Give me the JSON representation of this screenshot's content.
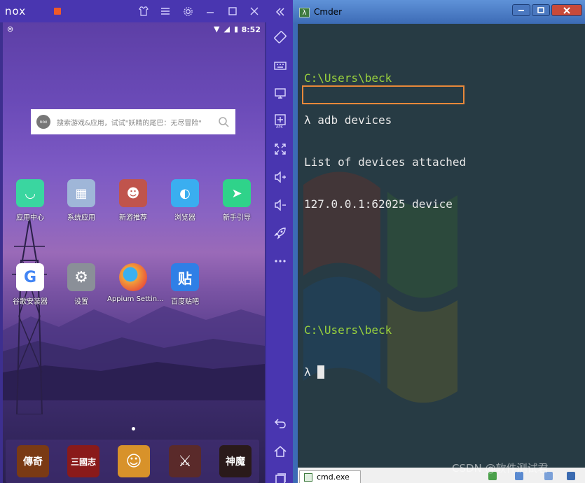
{
  "nox": {
    "logo": "nox",
    "status": {
      "time": "8:52",
      "battery": "▮",
      "wifi": "▼"
    },
    "search": {
      "placeholder": "搜索游戏&应用，试试\"妖精的尾巴：无尽冒险\"",
      "logo_text": "nox"
    },
    "apps_row1": [
      {
        "label": "应用中心",
        "color": "#3ad6a0",
        "glyph": "◡"
      },
      {
        "label": "系统应用",
        "color": "#9fb6d8",
        "glyph": "▦"
      },
      {
        "label": "新游推荐",
        "color": "#c0544c",
        "glyph": "☻"
      },
      {
        "label": "浏览器",
        "color": "#3aaef0",
        "glyph": "◐"
      },
      {
        "label": "新手引导",
        "color": "#2fd38a",
        "glyph": "➤"
      }
    ],
    "apps_row2": [
      {
        "label": "谷歌安装器",
        "color": "#ffffff",
        "glyph": "G"
      },
      {
        "label": "设置",
        "color": "#8a8f98",
        "glyph": "⚙"
      },
      {
        "label": "Appium Settin...",
        "color": "#f2a23a",
        "glyph": "◔"
      },
      {
        "label": "百度贴吧",
        "color": "#2f7fe6",
        "glyph": "贴"
      }
    ],
    "dock": [
      {
        "label": "傳奇",
        "color": "#7a3a14"
      },
      {
        "label": "三國志",
        "color": "#8a1a1a"
      },
      {
        "label": "☺",
        "color": "#d8922a"
      },
      {
        "label": "⚔",
        "color": "#5a2a2a"
      },
      {
        "label": "神魔",
        "color": "#2a1a1a"
      }
    ]
  },
  "cmder": {
    "title": "Cmder",
    "icon_glyph": "λ",
    "lines": [
      {
        "text": "C:\\Users\\beck",
        "color": "green"
      },
      {
        "text": "λ adb devices",
        "color": "white"
      },
      {
        "text": "List of devices attached",
        "color": "white"
      },
      {
        "text": "127.0.0.1:62025 device",
        "color": "white"
      },
      {
        "text": "",
        "color": "white"
      },
      {
        "text": "",
        "color": "white"
      },
      {
        "text": "C:\\Users\\beck",
        "color": "green"
      },
      {
        "text": "λ ",
        "color": "white"
      }
    ],
    "tab_label": "cmd.exe",
    "highlight_color": "#e8883a"
  },
  "watermark": "CSDN @软件测试君"
}
